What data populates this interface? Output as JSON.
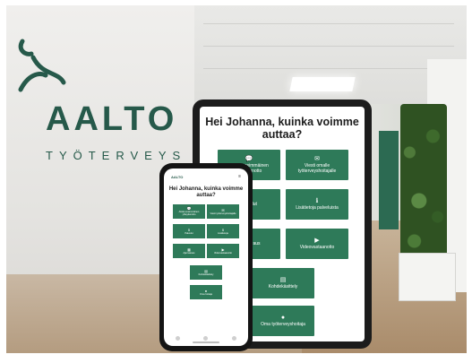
{
  "brand": {
    "name": "AALTO",
    "subtitle": "TYÖTERVEYS",
    "color": "#26594a"
  },
  "tablet": {
    "heading": "Hei Johanna, kuinka voimme auttaa?",
    "buttons": [
      {
        "label": "Aloita ensimmäinen yhteydenotto",
        "icon": "chat-icon"
      },
      {
        "label": "Viesti omalle työterveyshoitajalle",
        "icon": "mail-icon"
      },
      {
        "label": "Palvelut",
        "icon": ""
      },
      {
        "label": "Lisätietoja palveluista",
        "icon": "info-icon"
      },
      {
        "label": "Ajanvaraus",
        "icon": ""
      },
      {
        "label": "Videovastaanotto",
        "icon": "video-icon"
      },
      {
        "label": "Kohdekäsittely",
        "icon": "clipboard-icon"
      },
      {
        "label": "Oma työterveyshoitaja",
        "icon": "person-icon"
      }
    ],
    "button_color": "#2e7a59"
  },
  "phone": {
    "brand": "AALTO",
    "heading": "Hei Johanna, kuinka voimme auttaa?",
    "buttons": [
      {
        "label": "Aloita ensimmäinen yhteydenotto",
        "icon": "chat-icon"
      },
      {
        "label": "Viesti työterveyshoitajalle",
        "icon": "mail-icon"
      },
      {
        "label": "Palvelut",
        "icon": "info-icon"
      },
      {
        "label": "Lisätietoja",
        "icon": "info-icon"
      },
      {
        "label": "Ajanvaraus",
        "icon": "calendar-icon"
      },
      {
        "label": "Videovastaanotto",
        "icon": "video-icon"
      },
      {
        "label": "Kohdekäsittely",
        "icon": "clipboard-icon"
      },
      {
        "label": "Oma hoitaja",
        "icon": "person-icon"
      }
    ]
  }
}
